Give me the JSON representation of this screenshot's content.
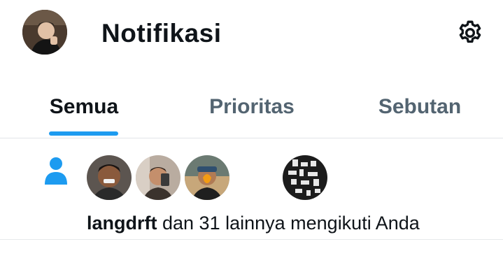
{
  "header": {
    "title": "Notifikasi",
    "avatar_icon": "profile-avatar",
    "settings_icon": "gear-icon"
  },
  "tabs": [
    {
      "label": "Semua",
      "active": true
    },
    {
      "label": "Prioritas",
      "active": false
    },
    {
      "label": "Sebutan",
      "active": false
    }
  ],
  "notification": {
    "type_icon": "person-icon",
    "username": "langdrft",
    "message": " dan 31 lainnya mengikuti Anda"
  },
  "colors": {
    "accent": "#1d9bf0",
    "text_primary": "#0f1419",
    "text_secondary": "#536471"
  }
}
